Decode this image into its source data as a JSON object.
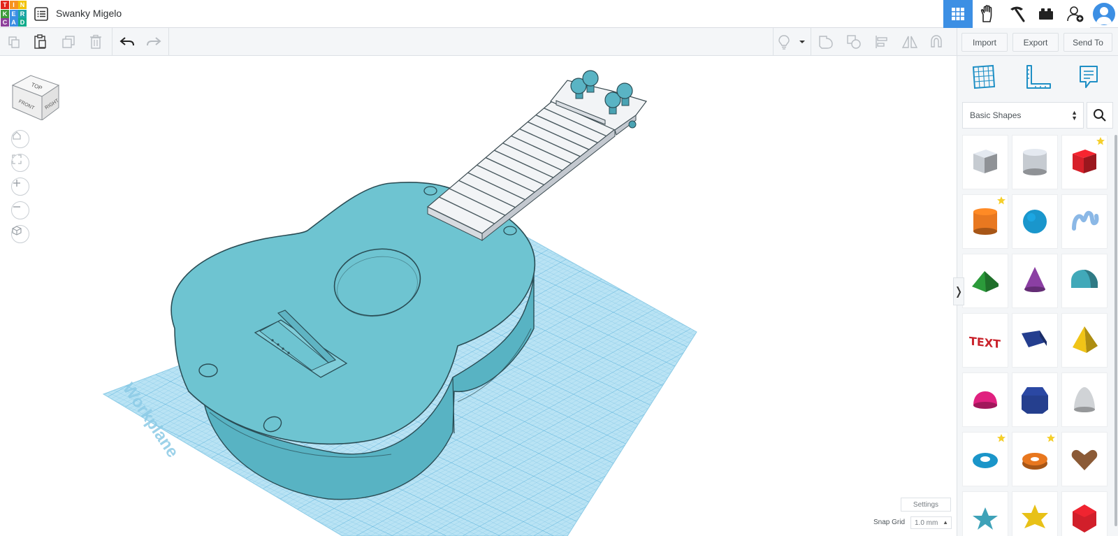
{
  "app": {
    "logo_letters": [
      "T",
      "I",
      "N",
      "K",
      "E",
      "R",
      "C",
      "A",
      "D"
    ],
    "logo_colors": [
      "#e2231a",
      "#f7931e",
      "#f2c203",
      "#3e9b3a",
      "#3c8fe4",
      "#1da6a4",
      "#8d3f9b",
      "#3c8fe4",
      "#11ab8c"
    ],
    "document_title": "Swanky Migelo"
  },
  "top_nav": {
    "items": [
      {
        "name": "3d-design-view",
        "icon": "grid-icon",
        "active": true
      },
      {
        "name": "circuits",
        "icon": "glove-icon",
        "active": false
      },
      {
        "name": "codeblocks",
        "icon": "pickaxe-icon",
        "active": false
      },
      {
        "name": "bricks",
        "icon": "brick-icon",
        "active": false
      },
      {
        "name": "invite-people",
        "icon": "add-user-icon",
        "active": false
      }
    ],
    "accent_color": "#3c8fe4"
  },
  "toolbar": {
    "tools": [
      "copy",
      "paste",
      "duplicate",
      "delete",
      "undo",
      "redo"
    ],
    "right_tools": [
      "light-bulb",
      "dropdown",
      "group",
      "ungroup",
      "align",
      "mirror",
      "cruise"
    ],
    "import_label": "Import",
    "export_label": "Export",
    "send_to_label": "Send To"
  },
  "viewport": {
    "view_cube": {
      "top": "TOP",
      "front": "FRONT",
      "right": "RIGHT"
    },
    "workplane_label": "Workplane",
    "settings_label": "Settings",
    "snap_grid_label": "Snap Grid",
    "snap_grid_value": "1.0 mm",
    "model_color": "#6ec4d1",
    "workplane_color": "#a9dcf0"
  },
  "sidebar": {
    "category": "Basic Shapes",
    "shapes": [
      {
        "name": "Box (hole)",
        "color": "#c6cbd1",
        "starred": false
      },
      {
        "name": "Cylinder (hole)",
        "color": "#c6cbd1",
        "starred": false
      },
      {
        "name": "Box",
        "color": "#d7202a",
        "starred": true
      },
      {
        "name": "Cylinder",
        "color": "#e87820",
        "starred": true
      },
      {
        "name": "Sphere",
        "color": "#1a96cc",
        "starred": false
      },
      {
        "name": "Scribble",
        "color": "#8bb8e6",
        "starred": false
      },
      {
        "name": "Roof",
        "color": "#2b9a3a",
        "starred": false
      },
      {
        "name": "Cone",
        "color": "#8b3fa3",
        "starred": false
      },
      {
        "name": "Round Roof",
        "color": "#41a9b9",
        "starred": false
      },
      {
        "name": "Text",
        "color": "#c9222b",
        "starred": false
      },
      {
        "name": "Wedge",
        "color": "#243e8f",
        "starred": false
      },
      {
        "name": "Pyramid",
        "color": "#f0c417",
        "starred": false
      },
      {
        "name": "Half Sphere",
        "color": "#e0207f",
        "starred": false
      },
      {
        "name": "Polygon",
        "color": "#253f8e",
        "starred": false
      },
      {
        "name": "Paraboloid",
        "color": "#d0d3d6",
        "starred": false
      },
      {
        "name": "Torus",
        "color": "#1a95c9",
        "starred": true
      },
      {
        "name": "Tube",
        "color": "#e8771e",
        "starred": true
      },
      {
        "name": "Heart",
        "color": "#8b5a36",
        "starred": false
      },
      {
        "name": "Star",
        "color": "#3ea2b8",
        "starred": false
      },
      {
        "name": "Star Six",
        "color": "#e8c117",
        "starred": false
      },
      {
        "name": "Icosahedron",
        "color": "#d11f2a",
        "starred": false
      }
    ],
    "text_shape_label": "TEXT"
  }
}
